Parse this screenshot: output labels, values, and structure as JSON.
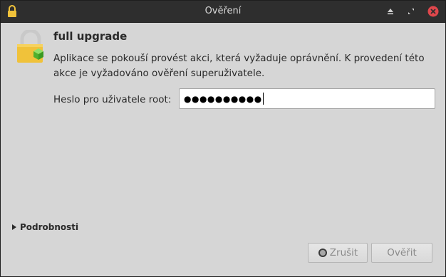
{
  "window": {
    "title": "Ověření"
  },
  "dialog": {
    "heading": "full upgrade",
    "message": "Aplikace se pokouší provést akci, která vyžaduje oprávnění. K provedení této akce je vyžadováno ověření superuživatele.",
    "password_label": "Heslo pro uživatele root:",
    "password_value": "●●●●●●●●●●",
    "details_label": "Podrobnosti"
  },
  "buttons": {
    "cancel_label": "Zrušit",
    "authenticate_label": "Ověřit"
  },
  "icons": {
    "title": "lock-icon",
    "dialog": "padlock-with-package-icon",
    "details": "disclosure-triangle-icon",
    "cancel": "cancel-icon",
    "titlebar_buttons": [
      "eject-icon",
      "resize-icon",
      "close-icon"
    ]
  },
  "colors": {
    "titlebar": "#2e2e2e",
    "window_bg": "#d6d6d6",
    "close_button": "#e0474c",
    "lock_yellow": "#f0c23a",
    "package_green": "#5cc43a"
  }
}
